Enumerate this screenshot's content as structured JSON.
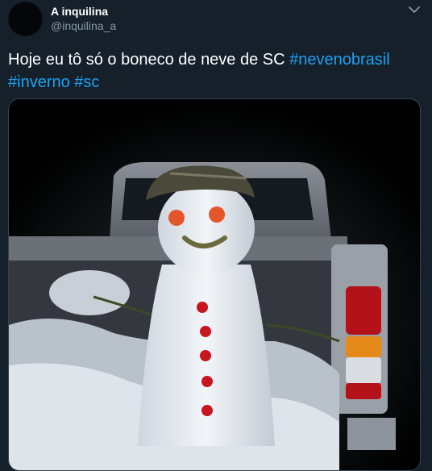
{
  "tweet": {
    "author_name": "A inquilina",
    "author_handle": "@inquilina_a",
    "text_prefix": "Hoje eu tô só o boneco de neve de SC ",
    "hashtags": [
      "#nevenobrasil",
      "#inverno",
      "#sc"
    ],
    "icons": {
      "menu": "chevron-down-icon",
      "avatar": "avatar"
    },
    "colors": {
      "background": "#15202b",
      "link": "#1da1f2",
      "secondary_text": "#8899a6"
    }
  }
}
